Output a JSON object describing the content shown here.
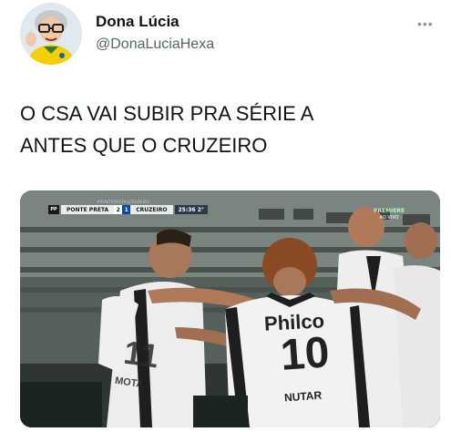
{
  "tweet": {
    "author_name": "Dona Lúcia",
    "author_handle": "@DonaLuciaHexa",
    "more_label": "•••",
    "text_lines": [
      "O CSA VAI SUBIR PRA SÉRIE A",
      "ANTES QUE O CRUZEIRO"
    ]
  },
  "media": {
    "scorebug": {
      "home_logo_text": "PP",
      "home_team": "PONTE PRETA",
      "home_score": "2",
      "away_score": "1",
      "away_team": "CRUZEIRO",
      "clock": "25:36 2°"
    },
    "hashtag": "#PONTEPRETAxCRUZEIRO",
    "broadcaster": "PREMIERE",
    "broadcaster_sub": "AO VIVO",
    "sponsor": "Philco",
    "shirt_number": "10",
    "shirt_name": "NUTAR",
    "shirt_number_2": "11",
    "shirt_name_2": "MOTA"
  },
  "colors": {
    "text_primary": "#0f1419",
    "text_secondary": "#536471",
    "kit_white": "#f2f2f2",
    "kit_black": "#1e1e1e"
  }
}
